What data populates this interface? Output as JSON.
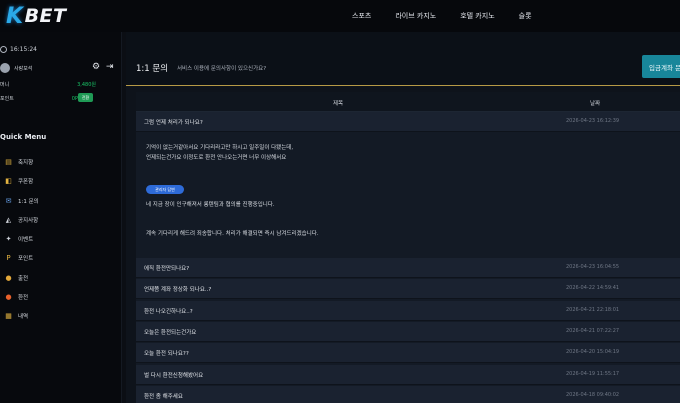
{
  "brand": {
    "logo_k": "K",
    "logo_rest": "BET"
  },
  "nav": [
    "스포츠",
    "라이브 카지노",
    "호텔 카지노",
    "슬롯"
  ],
  "sidebar": {
    "time": "16:15:24",
    "username": "사랑보석",
    "money_label": "머니",
    "money_value": "3,480원",
    "point_label": "포인트",
    "point_value": "0P",
    "point_change": "전환",
    "quick_menu": "Quick Menu",
    "menu": [
      {
        "label": "축지향",
        "icon": "box-icon",
        "glyph": "▤",
        "color": "#e3b341"
      },
      {
        "label": "쿠폰함",
        "icon": "coupon-icon",
        "glyph": "◧",
        "color": "#e3b341"
      },
      {
        "label": "1:1 문의",
        "icon": "chat-icon",
        "glyph": "✉",
        "color": "#6aa5f0"
      },
      {
        "label": "공지사항",
        "icon": "notice-icon",
        "glyph": "◭",
        "color": "#cfd3da"
      },
      {
        "label": "이벤트",
        "icon": "event-icon",
        "glyph": "✦",
        "color": "#cfd3da"
      },
      {
        "label": "포인트",
        "icon": "point-icon",
        "glyph": "P",
        "color": "#e3b341"
      },
      {
        "label": "출전",
        "icon": "deposit-icon",
        "glyph": "●",
        "color": "#e3a83a"
      },
      {
        "label": "환전",
        "icon": "withdraw-icon",
        "glyph": "●",
        "color": "#e8602a"
      },
      {
        "label": "내역",
        "icon": "history-icon",
        "glyph": "▦",
        "color": "#e3b341"
      }
    ]
  },
  "main": {
    "title": "1:1 문의",
    "subtitle": "서비스 이용에 문의사항이 있으신가요?",
    "inquiry_button": "입금계좌 문의",
    "col_title": "제목",
    "col_date": "날짜",
    "open_row": {
      "title": "그럼 언제 처리가 되나요?",
      "date": "2026-04-23 16:12:39"
    },
    "question_lines": [
      "기억이 없는거같아서요 기다리라고만 하시고 일주일이 다됐는데,",
      "언제되는건가요 이정도로 환전 안나오는거면 너무 이상해서요"
    ],
    "admin_badge": "관리자 답변",
    "answer_lines": [
      "네 지금 장이 인구해져서 롱텐팀과 협의를 진행중입니다.",
      "계속 기다리게 해드려 죄송합니다. 처리가 해결되면 즉시 남겨드리겠습니다."
    ],
    "rows": [
      {
        "title": "에직 환전만되나요?",
        "date": "2026-04-23 16:04:55"
      },
      {
        "title": "언제쯤 계좌 정상화 되나요..?",
        "date": "2026-04-22 14:59:41"
      },
      {
        "title": "환전 나오긴하나요..?",
        "date": "2026-04-21 22:18:01"
      },
      {
        "title": "오늘은 환전되는건가요",
        "date": "2026-04-21 07:22:27"
      },
      {
        "title": "오늘 환전 되나요??",
        "date": "2026-04-20 15:04:19"
      },
      {
        "title": "벌 다시 환전신청해봤어요",
        "date": "2026-04-19 11:55:17"
      },
      {
        "title": "환전 좀 해주세요",
        "date": "2026-04-18 09:40:02"
      }
    ]
  },
  "colors": {
    "accent": "#18869a",
    "gold_line": "#b79a46",
    "green": "#19c266"
  }
}
